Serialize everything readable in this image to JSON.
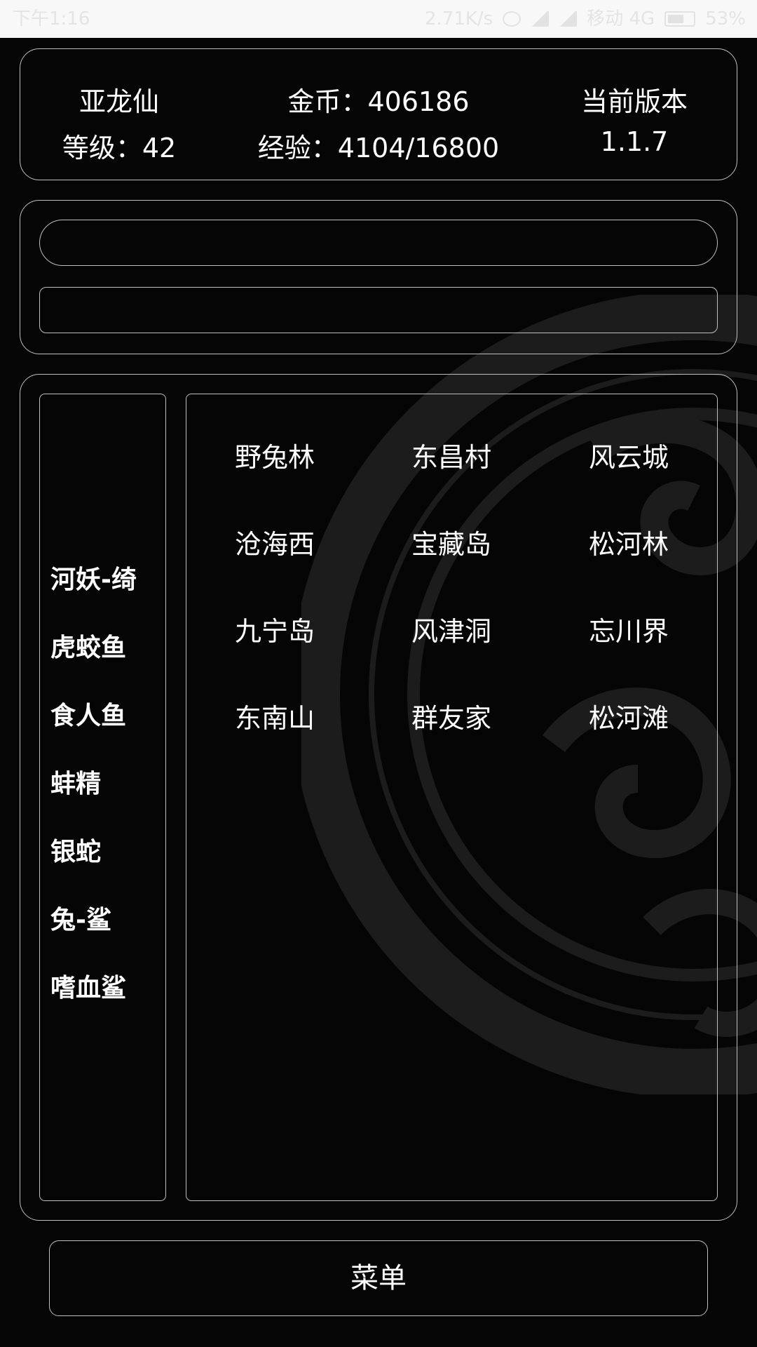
{
  "status_bar": {
    "time": "下午1:16",
    "net_speed": "2.71K/s",
    "carrier": "移动 4G",
    "battery": "53%"
  },
  "player": {
    "name": "亚龙仙",
    "level_text": "等级：42",
    "gold_text": "金币：406186",
    "exp_text": "经验：4104/16800",
    "version_label": "当前版本",
    "version": "1.1.7"
  },
  "monsters": [
    "河妖-绮",
    "虎蛟鱼",
    "食人鱼",
    "蚌精",
    "银蛇",
    "兔-鲨",
    "嗜血鲨"
  ],
  "locations": [
    [
      "野兔林",
      "东昌村",
      "风云城"
    ],
    [
      "沧海西",
      "宝藏岛",
      "松河林"
    ],
    [
      "九宁岛",
      "风津洞",
      "忘川界"
    ],
    [
      "东南山",
      "群友家",
      "松河滩"
    ]
  ],
  "menu_label": "菜单"
}
